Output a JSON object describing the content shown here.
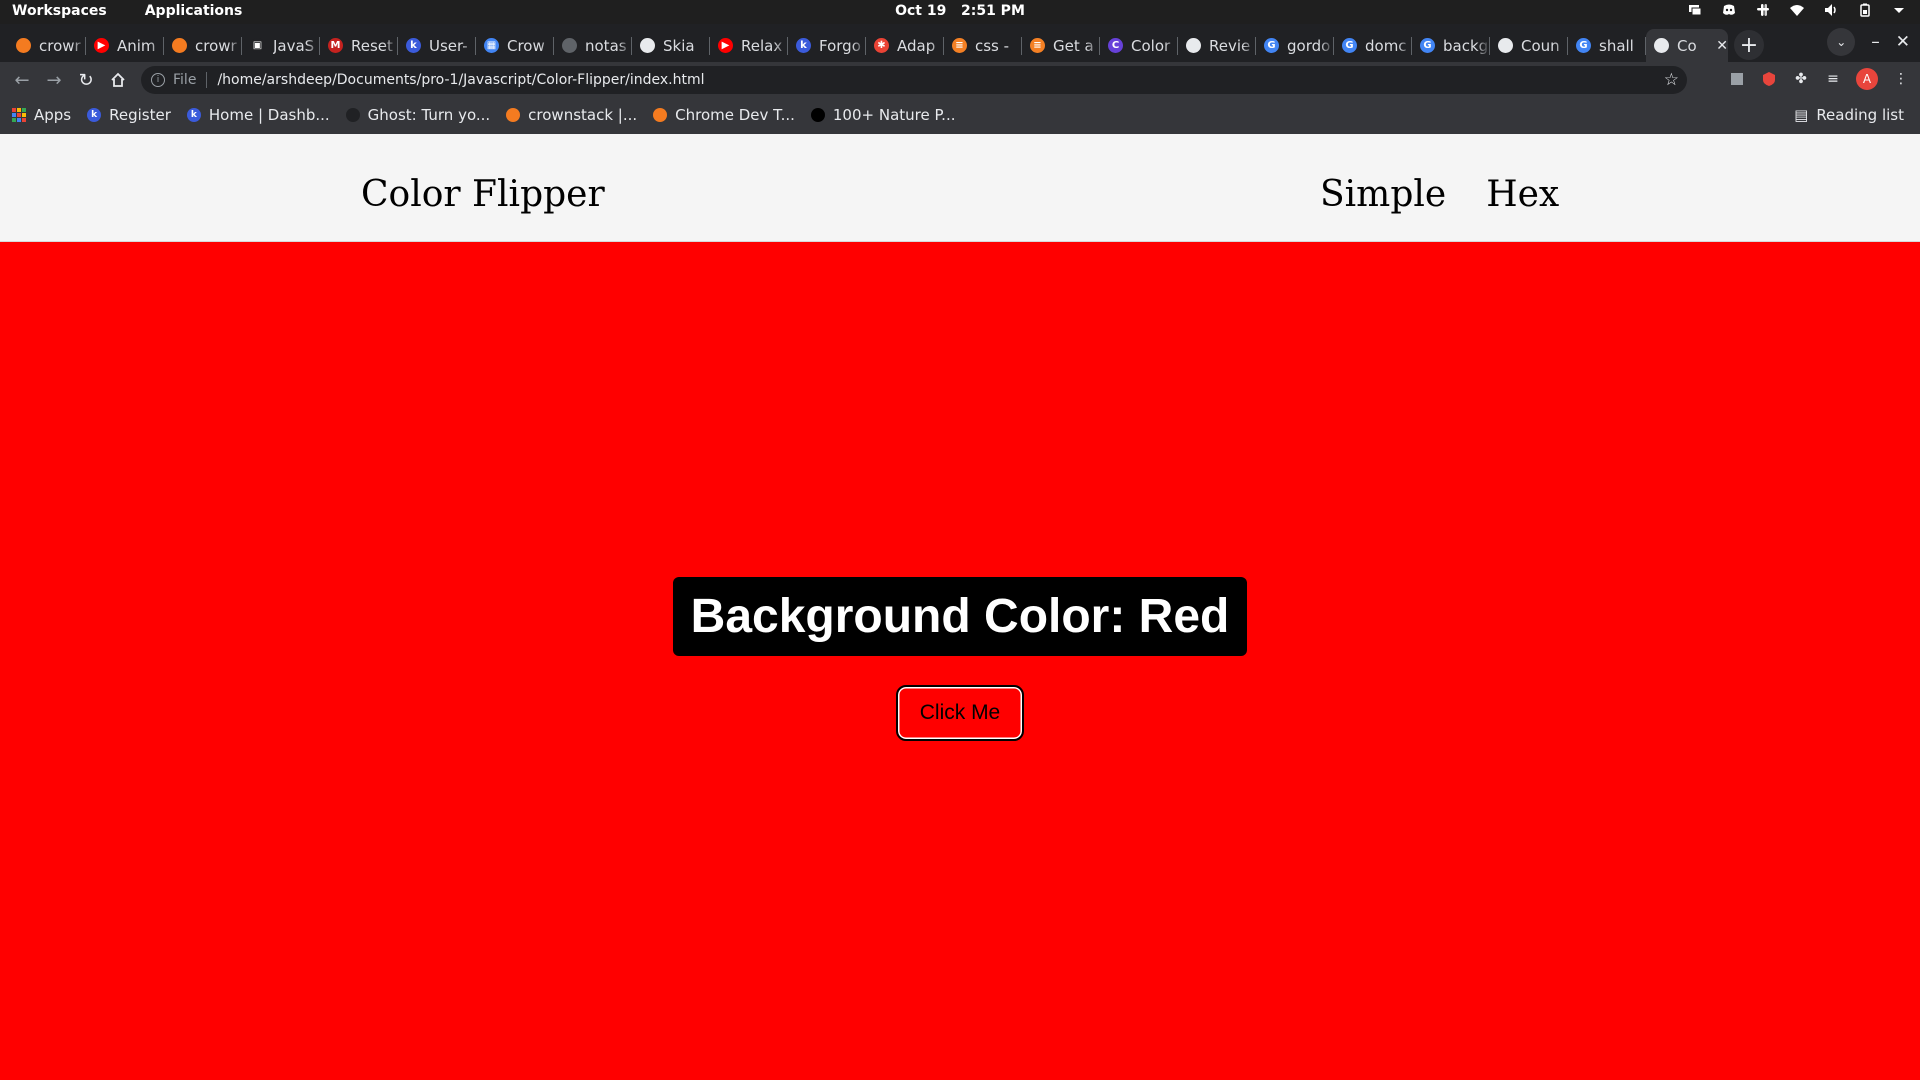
{
  "system_bar": {
    "workspaces": "Workspaces",
    "applications": "Applications",
    "date": "Oct 19",
    "time": "2:51 PM",
    "tray_icons": [
      "screen-icon",
      "discord-icon",
      "slack-icon",
      "wifi-icon",
      "volume-icon",
      "battery-icon",
      "chevron-down-icon"
    ]
  },
  "browser": {
    "tabs": [
      {
        "title": "crowr",
        "color": "#f47b20",
        "glyph": ""
      },
      {
        "title": "Anim",
        "color": "#ff0000",
        "glyph": "▶"
      },
      {
        "title": "crowr",
        "color": "#f47b20",
        "glyph": ""
      },
      {
        "title": "JavaS",
        "color": "#202124",
        "glyph": "▣"
      },
      {
        "title": "Reset",
        "color": "#c5221f",
        "glyph": "M"
      },
      {
        "title": "User-",
        "color": "#3b5bdb",
        "glyph": "k"
      },
      {
        "title": "Crow",
        "color": "#4285f4",
        "glyph": "▦"
      },
      {
        "title": "notas",
        "color": "#5f6368",
        "glyph": ""
      },
      {
        "title": "Skia",
        "color": "#e8eaed",
        "glyph": ""
      },
      {
        "title": "Relax",
        "color": "#ff0000",
        "glyph": "▶"
      },
      {
        "title": "Forgo",
        "color": "#3b5bdb",
        "glyph": "k"
      },
      {
        "title": "Adap",
        "color": "#ea4335",
        "glyph": "✱"
      },
      {
        "title": "css -",
        "color": "#f48024",
        "glyph": "≡"
      },
      {
        "title": "Get a",
        "color": "#f48024",
        "glyph": "≡"
      },
      {
        "title": "Color",
        "color": "#6741d9",
        "glyph": "C"
      },
      {
        "title": "Revie",
        "color": "#e8eaed",
        "glyph": ""
      },
      {
        "title": "gordo",
        "color": "#4285f4",
        "glyph": "G"
      },
      {
        "title": "domc",
        "color": "#4285f4",
        "glyph": "G"
      },
      {
        "title": "backg",
        "color": "#4285f4",
        "glyph": "G"
      },
      {
        "title": "Coun",
        "color": "#e8eaed",
        "glyph": ""
      },
      {
        "title": "shall",
        "color": "#4285f4",
        "glyph": "G"
      },
      {
        "title": "Co",
        "color": "#e8eaed",
        "glyph": "",
        "active": true
      }
    ],
    "new_tab": "+",
    "address": {
      "scheme": "File",
      "url": "/home/arshdeep/Documents/pro-1/Javascript/Color-Flipper/index.html"
    },
    "profile_initial": "A",
    "bookmarks": [
      {
        "label": "Apps",
        "icon": "apps-grid-icon",
        "color": ""
      },
      {
        "label": "Register",
        "icon": "k-icon",
        "color": "#3b5bdb"
      },
      {
        "label": "Home | Dashb...",
        "icon": "k-icon",
        "color": "#3b5bdb"
      },
      {
        "label": "Ghost: Turn yo...",
        "icon": "ghost-icon",
        "color": "#202124"
      },
      {
        "label": "crownstack |...",
        "icon": "crownstack-icon",
        "color": "#f47b20"
      },
      {
        "label": "Chrome Dev T...",
        "icon": "crownstack-icon",
        "color": "#f47b20"
      },
      {
        "label": "100+ Nature P...",
        "icon": "unsplash-icon",
        "color": "#000000"
      }
    ],
    "reading_list": "Reading list"
  },
  "page": {
    "site_title": "Color Flipper",
    "nav": [
      "Simple",
      "Hex"
    ],
    "color_label": "Background Color: Red",
    "button": "Click Me",
    "background_color": "#ff0000"
  }
}
